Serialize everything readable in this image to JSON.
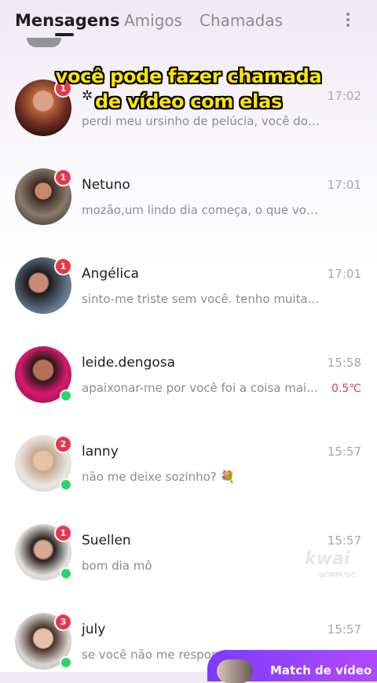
{
  "tabs": [
    {
      "label": "Mensagens",
      "active": true
    },
    {
      "label": "Amigos",
      "active": false
    },
    {
      "label": "Chamadas",
      "active": false
    }
  ],
  "caption": {
    "line1": "você pode fazer chamada",
    "line2": "de vídeo com elas"
  },
  "conversations": [
    {
      "name": "✲ ",
      "time": "17:02",
      "preview": "perdi meu ursinho de pelúcia, você dor...",
      "unread": "1",
      "online": false,
      "temperature": ""
    },
    {
      "name": "Netuno",
      "time": "17:01",
      "preview": "mozão,um lindo dia começa, o que voc...",
      "unread": "1",
      "online": false,
      "temperature": ""
    },
    {
      "name": "Angélica",
      "time": "17:01",
      "preview": "sinto-me triste sem você. tenho muita...",
      "unread": "1",
      "online": false,
      "temperature": ""
    },
    {
      "name": "leide.dengosa",
      "time": "15:58",
      "preview": "apaixonar-me por você foi a coisa mai...",
      "unread": "",
      "online": true,
      "temperature": "0.5℃"
    },
    {
      "name": "lanny",
      "time": "15:57",
      "preview": "não me deixe sozinho? 💐",
      "unread": "2",
      "online": true,
      "temperature": ""
    },
    {
      "name": "Suellen",
      "time": "15:57",
      "preview": "bom dia mô",
      "unread": "1",
      "online": true,
      "temperature": ""
    },
    {
      "name": "july",
      "time": "15:57",
      "preview": "se você não me respond",
      "unread": "3",
      "online": true,
      "temperature": ""
    }
  ],
  "watermark": {
    "brand": "kwai",
    "handle": "@DMMUSIC"
  },
  "match_video": {
    "label": "Match de vídeo"
  },
  "colors": {
    "unread_badge": "#e5384d",
    "online_dot": "#2bd46b",
    "caption_text": "#ffe600",
    "match_button": "#8a3dff"
  }
}
